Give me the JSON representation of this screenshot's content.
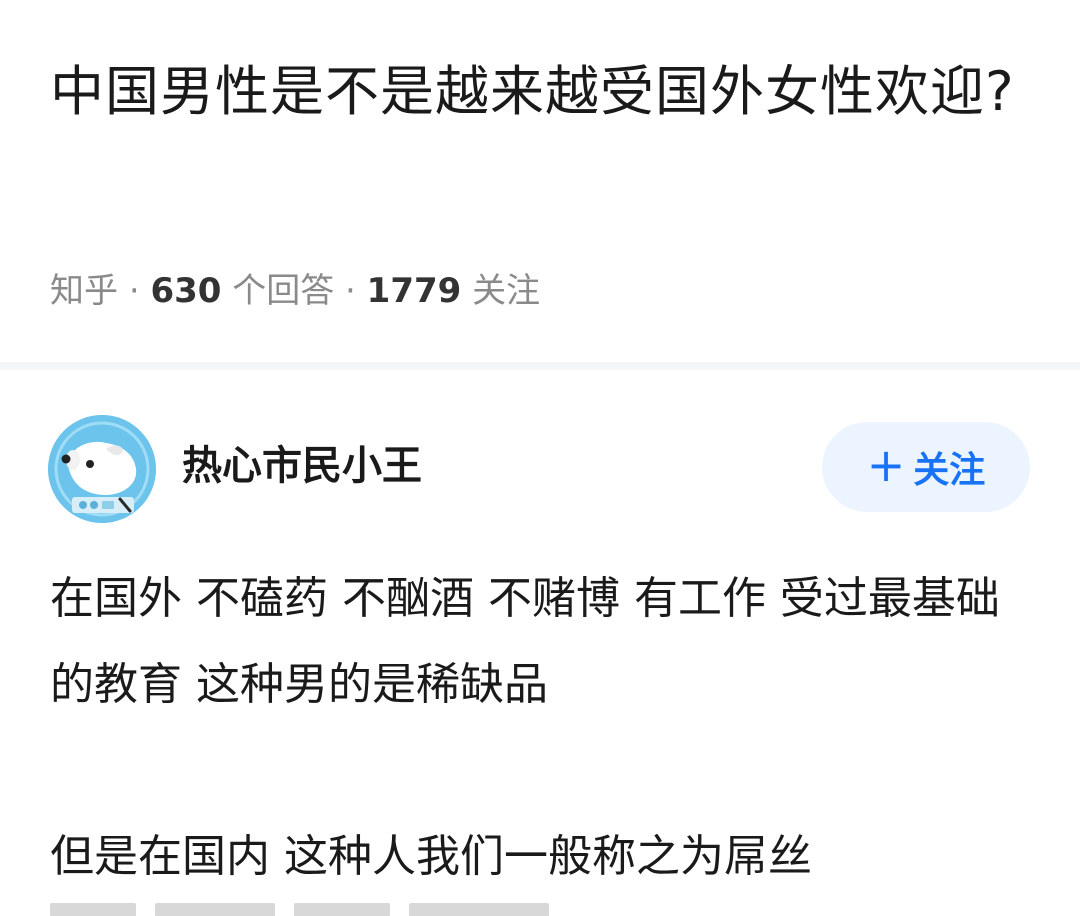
{
  "question": {
    "title": "中国男性是不是越来越受国外女性欢迎?",
    "source": "知乎",
    "separator": "·",
    "answer_count": "630",
    "answer_label": "个回答",
    "follower_count": "1779",
    "follower_label": "关注"
  },
  "answer": {
    "author_name": "热心市民小王",
    "follow_button": {
      "icon": "+",
      "label": "关注"
    },
    "paragraphs": [
      "在国外 不磕药 不酗酒 不赌博 有工作 受过最基础的教育 这种男的是稀缺品",
      "但是在国内 这种人我们一般称之为屌丝"
    ]
  },
  "colors": {
    "accent": "#1772f6",
    "follow_bg": "#ebf4ff",
    "meta": "#8a8a8a",
    "avatar_bg": "#6cc4ec"
  },
  "icons": {
    "avatar": "cartoon-dog-astronaut-avatar",
    "follow": "plus-icon"
  }
}
